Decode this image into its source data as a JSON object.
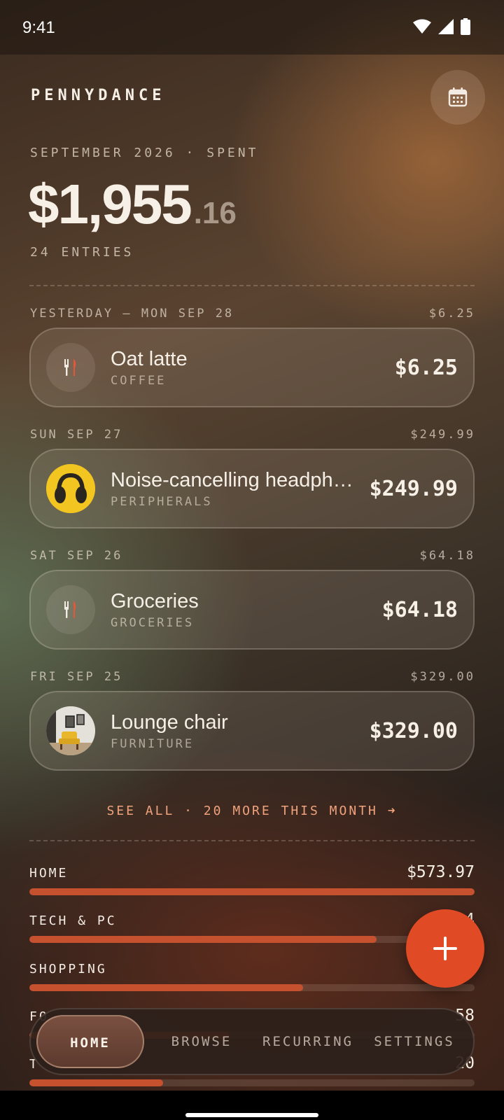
{
  "status_bar": {
    "time": "9:41"
  },
  "app": {
    "brand": "PENNYDANCE"
  },
  "summary": {
    "period_label": "SEPTEMBER 2026 · SPENT",
    "total_main": "$1,955",
    "total_cents": ".16",
    "entries_label": "24 ENTRIES"
  },
  "days": [
    {
      "label": "YESTERDAY — MON SEP 28",
      "day_total": "$6.25",
      "entry": {
        "title": "Oat latte",
        "category": "COFFEE",
        "amount": "$6.25",
        "thumb": "utensils-icon"
      }
    },
    {
      "label": "SUN SEP 27",
      "day_total": "$249.99",
      "entry": {
        "title": "Noise-cancelling headphones",
        "category": "PERIPHERALS",
        "amount": "$249.99",
        "thumb": "headphones-photo"
      }
    },
    {
      "label": "SAT SEP 26",
      "day_total": "$64.18",
      "entry": {
        "title": "Groceries",
        "category": "GROCERIES",
        "amount": "$64.18",
        "thumb": "utensils-icon"
      }
    },
    {
      "label": "FRI SEP 25",
      "day_total": "$329.00",
      "entry": {
        "title": "Lounge chair",
        "category": "FURNITURE",
        "amount": "$329.00",
        "thumb": "chair-photo"
      }
    }
  ],
  "see_all": "SEE ALL · 20 MORE THIS MONTH ➜",
  "categories": [
    {
      "name": "HOME",
      "amount": "$573.97",
      "fraction": 1.0
    },
    {
      "name": "TECH & PC",
      "amount": "$4",
      "fraction": 0.78
    },
    {
      "name": "SHOPPING",
      "amount": "$",
      "fraction": 0.615
    },
    {
      "name": "FO",
      "amount": "58",
      "fraction": 0.45
    },
    {
      "name": "T",
      "amount": "20",
      "fraction": 0.3
    }
  ],
  "nav": {
    "tabs": [
      {
        "label": "HOME",
        "active": true
      },
      {
        "label": "BROWSE",
        "active": false
      },
      {
        "label": "RECURRING",
        "active": false
      },
      {
        "label": "SETTINGS",
        "active": false
      }
    ]
  },
  "colors": {
    "accent": "#e04a24",
    "bar_fill": "#c6512f",
    "link": "#f0a27c"
  }
}
